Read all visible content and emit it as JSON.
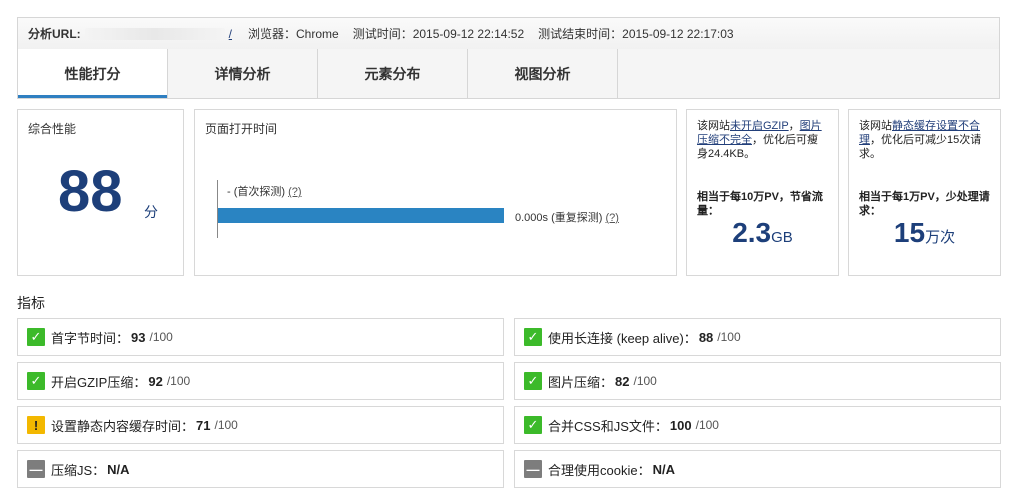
{
  "header": {
    "url_label": "分析URL:",
    "url_tail": "/",
    "browser": "浏览器：Chrome",
    "test_time": "测试时间：2015-09-12 22:14:52",
    "end_time": "测试结束时间：2015-09-12 22:17:03"
  },
  "tabs": [
    {
      "label": "性能打分",
      "active": true
    },
    {
      "label": "详情分析"
    },
    {
      "label": "元素分布"
    },
    {
      "label": "视图分析"
    }
  ],
  "score_card": {
    "label": "综合性能",
    "score": "88",
    "unit": "分"
  },
  "time_card": {
    "label": "页面打开时间",
    "first_visit": "- (首次探测)",
    "repeat_visit": "0.000s (重复探测)",
    "help": "(?)"
  },
  "tip_a": {
    "prefix": "该网站",
    "link1": "未开启GZIP",
    "sep": "，",
    "link2": "图片压缩不完全",
    "suffix": "，优化后可瘦身24.4KB。",
    "sub": "相当于每10万PV，节省流量：",
    "value": "2.3",
    "unit": "GB"
  },
  "tip_b": {
    "prefix": "该网站",
    "link": "静态缓存设置不合理",
    "suffix": "，优化后可减少15次请求。",
    "sub": "相当于每1万PV，少处理请求：",
    "value": "15",
    "unit": "万次"
  },
  "metrics_title": "指标",
  "metrics": [
    {
      "label": "首字节时间：",
      "score": "93",
      "max": "/100",
      "status": "pass"
    },
    {
      "label": "使用长连接 (keep alive)：",
      "score": "88",
      "max": "/100",
      "status": "pass"
    },
    {
      "label": "开启GZIP压缩：",
      "score": "92",
      "max": "/100",
      "status": "pass"
    },
    {
      "label": "图片压缩：",
      "score": "82",
      "max": "/100",
      "status": "pass"
    },
    {
      "label": "设置静态内容缓存时间：",
      "score": "71",
      "max": "/100",
      "status": "warn"
    },
    {
      "label": "合并CSS和JS文件：",
      "score": "100",
      "max": "/100",
      "status": "pass"
    },
    {
      "label": "压缩JS：",
      "score": "N/A",
      "max": "",
      "status": "na"
    },
    {
      "label": "合理使用cookie：",
      "score": "N/A",
      "max": "",
      "status": "na"
    }
  ],
  "colors": {
    "accent": "#2f7fc1",
    "score_blue": "#1d3f7a",
    "pass": "#3cba2a",
    "warn": "#f3b800",
    "na": "#7d7d7d"
  }
}
